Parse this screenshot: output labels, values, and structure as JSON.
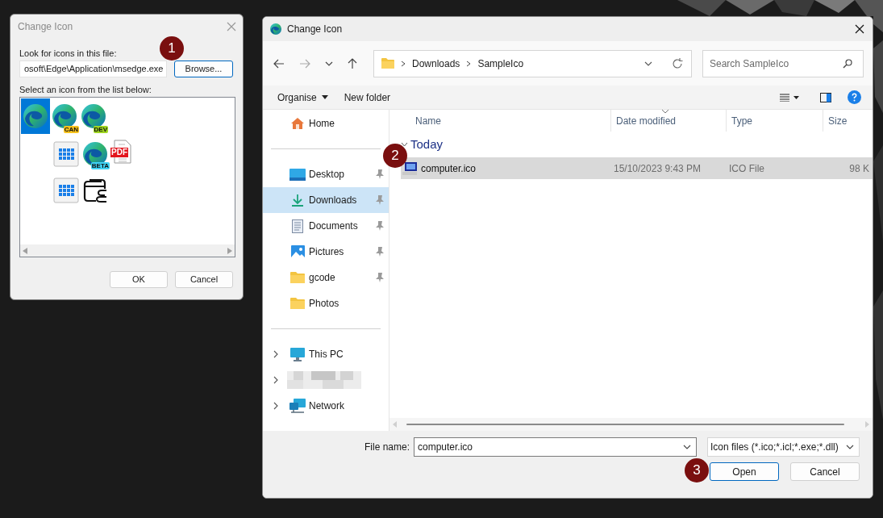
{
  "icon_dialog": {
    "title": "Change Icon",
    "file_label": "Look for icons in this file:",
    "file_path": "osoft\\Edge\\Application\\msedge.exe",
    "browse_button": "Browse...",
    "list_label": "Select an icon from the list below:",
    "icon_rows": [
      [
        {
          "kind": "edge",
          "selected": true
        },
        {
          "kind": "edge",
          "badge": "CAN",
          "color": "#f8c21c",
          "selected": false
        },
        {
          "kind": "edge",
          "badge": "DEV",
          "color": "#9ed520",
          "selected": false
        }
      ],
      [
        {
          "kind": "grid",
          "selected": false
        },
        {
          "kind": "edge",
          "badge": "BETA",
          "color": "#3fd3f5",
          "selected": false
        },
        {
          "kind": "pdf",
          "badge": "PDF",
          "color": "#e3161e",
          "selected": false
        }
      ],
      [
        {
          "kind": "grid",
          "selected": false
        },
        {
          "kind": "wallet",
          "selected": false
        }
      ]
    ],
    "buttons": [
      "OK",
      "Cancel"
    ]
  },
  "file_dialog": {
    "title": "Change Icon",
    "path": [
      "Downloads",
      "SampleIco"
    ],
    "search_placeholder": "Search SampleIco",
    "commands": [
      "Organise",
      "New folder"
    ],
    "nav_sections": [
      [
        {
          "kind": "home",
          "label": "Home",
          "pinned": false,
          "selected": false
        }
      ],
      [
        {
          "kind": "desktop",
          "label": "Desktop",
          "pinned": true,
          "selected": false
        },
        {
          "kind": "downloads",
          "label": "Downloads",
          "pinned": true,
          "selected": true
        },
        {
          "kind": "documents",
          "label": "Documents",
          "pinned": true,
          "selected": false
        },
        {
          "kind": "pictures",
          "label": "Pictures",
          "pinned": true,
          "selected": false
        },
        {
          "kind": "folder",
          "label": "gcode",
          "pinned": true,
          "selected": false
        },
        {
          "kind": "folder",
          "label": "Photos",
          "pinned": false,
          "selected": false
        }
      ],
      [
        {
          "kind": "pc",
          "label": "This PC",
          "selected": false
        },
        {
          "kind": "redacted",
          "selected": false
        },
        {
          "kind": "network",
          "label": "Network",
          "selected": false
        }
      ]
    ],
    "columns": [
      "Name",
      "Date modified",
      "Type",
      "Size"
    ],
    "groups": [
      {
        "label": "Today",
        "files": [
          {
            "name": "computer.ico",
            "date": "15/10/2023 9:43 PM",
            "type": "ICO File",
            "size": "98 K",
            "selected": true
          }
        ]
      }
    ],
    "file_name_label": "File name:",
    "file_name": "computer.ico",
    "filter": "Icon files (*.ico;*.icl;*.exe;*.dll)",
    "buttons": [
      "Open",
      "Cancel"
    ]
  },
  "callouts": [
    "1",
    "2",
    "3"
  ]
}
